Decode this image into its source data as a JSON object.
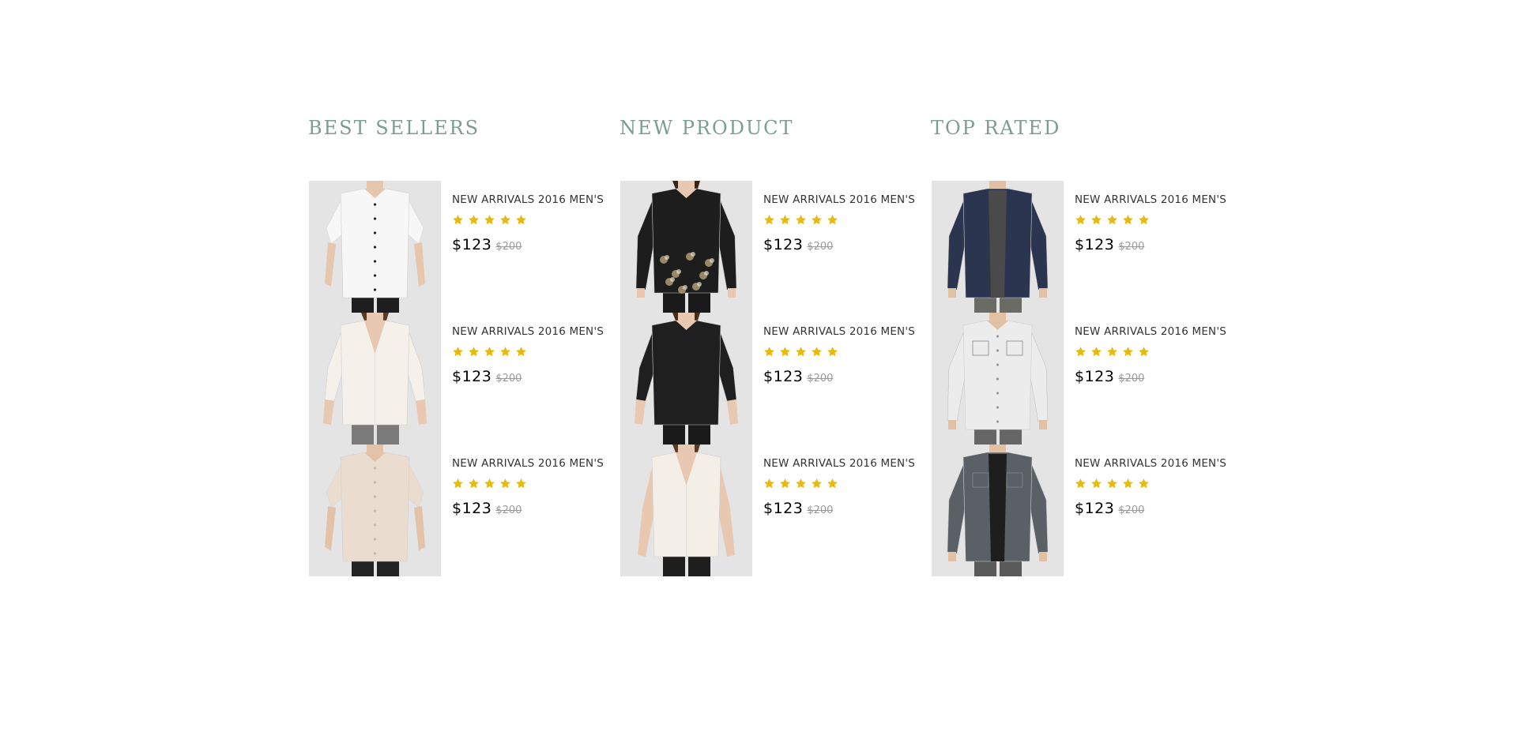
{
  "accent": "#7d9d8f",
  "star_color": "#e8b911",
  "columns": [
    {
      "title": "BEST SELLERS",
      "products": [
        {
          "name": "NEW ARRIVALS 2016 MEN'S",
          "rating": 5,
          "price": "$123",
          "old_price": "$200",
          "image": "white-short-sleeve-shirt"
        },
        {
          "name": "NEW ARRIVALS 2016 MEN'S",
          "rating": 5,
          "price": "$123",
          "old_price": "$200",
          "image": "cream-v-neck-blouse"
        },
        {
          "name": "NEW ARRIVALS 2016 MEN'S",
          "rating": 5,
          "price": "$123",
          "old_price": "$200",
          "image": "beige-short-sleeve-shirt"
        }
      ]
    },
    {
      "title": "NEW PRODUCT",
      "products": [
        {
          "name": "NEW ARRIVALS 2016 MEN'S",
          "rating": 5,
          "price": "$123",
          "old_price": "$200",
          "image": "black-floral-long-shirt"
        },
        {
          "name": "NEW ARRIVALS 2016 MEN'S",
          "rating": 5,
          "price": "$123",
          "old_price": "$200",
          "image": "black-blouse"
        },
        {
          "name": "NEW ARRIVALS 2016 MEN'S",
          "rating": 5,
          "price": "$123",
          "old_price": "$200",
          "image": "cream-sleeveless-top"
        }
      ]
    },
    {
      "title": "TOP RATED",
      "products": [
        {
          "name": "NEW ARRIVALS 2016 MEN'S",
          "rating": 5,
          "price": "$123",
          "old_price": "$200",
          "image": "navy-denim-shirt"
        },
        {
          "name": "NEW ARRIVALS 2016 MEN'S",
          "rating": 5,
          "price": "$123",
          "old_price": "$200",
          "image": "white-denim-shirt"
        },
        {
          "name": "NEW ARRIVALS 2016 MEN'S",
          "rating": 5,
          "price": "$123",
          "old_price": "$200",
          "image": "grey-denim-shirt"
        }
      ]
    }
  ]
}
